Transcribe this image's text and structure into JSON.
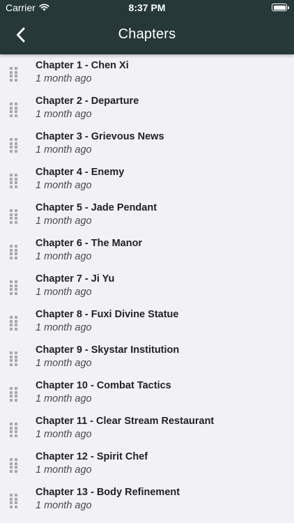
{
  "status_bar": {
    "carrier": "Carrier",
    "time": "8:37 PM"
  },
  "nav": {
    "title": "Chapters",
    "back_icon": "chevron-left-icon"
  },
  "colors": {
    "header_bg": "#263838",
    "list_bg": "#f2f2f6",
    "handle": "#a8a8a8"
  },
  "chapters": [
    {
      "title": "Chapter 1 - Chen Xi",
      "time": "1 month ago"
    },
    {
      "title": "Chapter 2 - Departure",
      "time": "1 month ago"
    },
    {
      "title": "Chapter 3 - Grievous News",
      "time": "1 month ago"
    },
    {
      "title": "Chapter 4 - Enemy",
      "time": "1 month ago"
    },
    {
      "title": "Chapter 5 - Jade Pendant",
      "time": "1 month ago"
    },
    {
      "title": "Chapter 6 - The Manor",
      "time": "1 month ago"
    },
    {
      "title": "Chapter 7 - Ji Yu",
      "time": "1 month ago"
    },
    {
      "title": "Chapter 8 - Fuxi Divine Statue",
      "time": "1 month ago"
    },
    {
      "title": "Chapter 9 - Skystar Institution",
      "time": "1 month ago"
    },
    {
      "title": "Chapter 10 - Combat Tactics",
      "time": "1 month ago"
    },
    {
      "title": "Chapter 11 - Clear Stream Restaurant",
      "time": "1 month ago"
    },
    {
      "title": "Chapter 12 - Spirit Chef",
      "time": "1 month ago"
    },
    {
      "title": "Chapter 13 - Body Refinement",
      "time": "1 month ago"
    }
  ]
}
